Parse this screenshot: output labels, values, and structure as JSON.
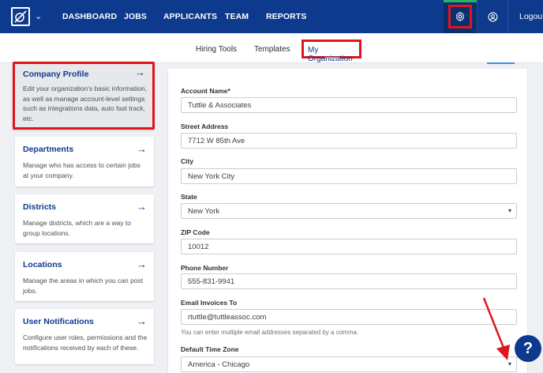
{
  "nav": {
    "items": [
      "DASHBOARD",
      "JOBS",
      "APPLICANTS",
      "TEAM",
      "REPORTS"
    ],
    "logout": "Logout",
    "icons": {
      "logo": "logo-icon",
      "settings": "gear-icon",
      "profile": "user-circle-icon"
    },
    "colors": {
      "bar": "#0d3a8c",
      "highlight": "#e0161b",
      "indicator": "#29b36a"
    }
  },
  "subnav": {
    "tabs": [
      "Hiring Tools",
      "Templates",
      "My Organization"
    ],
    "active": "My Organization"
  },
  "sidebar": {
    "cards": [
      {
        "title": "Company Profile",
        "desc": "Edit your organization's basic information, as well as manage account-level settings such as integrations data, auto fast track, etc."
      },
      {
        "title": "Departments",
        "desc": "Manage who has access to certain jobs at your company."
      },
      {
        "title": "Districts",
        "desc": "Manage districts, which are a way to group locations."
      },
      {
        "title": "Locations",
        "desc": "Manage the areas in which you can post jobs."
      },
      {
        "title": "User Notifications",
        "desc": "Configure user roles, permissions and the notifications received by each of these."
      }
    ]
  },
  "form": {
    "account_name_label": "Account Name*",
    "account_name": "Tuttle & Associates",
    "street_label": "Street Address",
    "street": "7712 W 85th Ave",
    "city_label": "City",
    "city": "New York City",
    "state_label": "State",
    "state": "New York",
    "zip_label": "ZIP Code",
    "zip": "10012",
    "phone_label": "Phone Number",
    "phone": "555-831-9941",
    "email_label": "Email Invoices To",
    "email": "rtuttle@tuttleassoc.com",
    "email_hint": "You can enter multiple email addresses separated by a comma.",
    "tz_label": "Default Time Zone",
    "tz": "America - Chicago"
  },
  "help": {
    "label": "?"
  }
}
